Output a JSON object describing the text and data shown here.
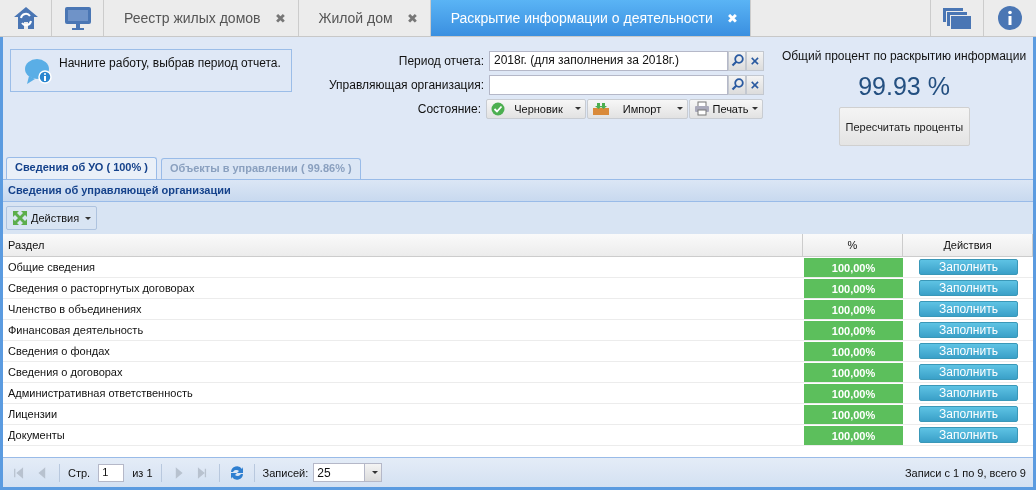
{
  "tabs": [
    {
      "label": "Реестр жилых домов",
      "selected": false,
      "close": "✖"
    },
    {
      "label": "Жилой дом",
      "selected": false,
      "close": "✖"
    },
    {
      "label": "Раскрытие информации о деятельности",
      "selected": true,
      "close": "✖"
    }
  ],
  "info_message": "Начните работу, выбрав период отчета.",
  "form": {
    "period_label": "Период отчета:",
    "period_value": "2018г. (для заполнения за 2018г.)",
    "org_label": "Управляющая организация:",
    "state_label": "Состояние:",
    "state_button": "Черновик",
    "import_button": "Импорт",
    "print_button": "Печать",
    "clear": "×"
  },
  "summary": {
    "title": "Общий процент по раскрытию информации",
    "percent": "99.93 %",
    "recalc_button": "Пересчитать проценты"
  },
  "subtabs": [
    {
      "label": "Сведения об УО ( 100% )",
      "selected": true
    },
    {
      "label": "Объекты в управлении ( 99.86% )",
      "selected": false
    }
  ],
  "panel_title": "Сведения об управляющей организации",
  "actions_button": "Действия",
  "table": {
    "columns": [
      "Раздел",
      "%",
      "Действия"
    ],
    "rows": [
      {
        "name": "Общие сведения",
        "percent": "100,00%",
        "action": "Заполнить"
      },
      {
        "name": "Сведения о расторгнутых договорах",
        "percent": "100,00%",
        "action": "Заполнить"
      },
      {
        "name": "Членство в объединениях",
        "percent": "100,00%",
        "action": "Заполнить"
      },
      {
        "name": "Финансовая деятельность",
        "percent": "100,00%",
        "action": "Заполнить"
      },
      {
        "name": "Сведения о фондах",
        "percent": "100,00%",
        "action": "Заполнить"
      },
      {
        "name": "Сведения о договорах",
        "percent": "100,00%",
        "action": "Заполнить"
      },
      {
        "name": "Административная ответственность",
        "percent": "100,00%",
        "action": "Заполнить"
      },
      {
        "name": "Лицензии",
        "percent": "100,00%",
        "action": "Заполнить"
      },
      {
        "name": "Документы",
        "percent": "100,00%",
        "action": "Заполнить"
      }
    ]
  },
  "pager": {
    "nav": [
      {
        "kind": "first",
        "disabled": true
      },
      {
        "kind": "prev",
        "disabled": true
      },
      {
        "kind": "next",
        "disabled": true
      },
      {
        "kind": "last",
        "disabled": true
      }
    ],
    "page_label": "Стр.",
    "page": "1",
    "of": "из 1",
    "size_label": "Записей:",
    "size": "25",
    "summary": "Записи с 1 по 9, всего 9"
  }
}
